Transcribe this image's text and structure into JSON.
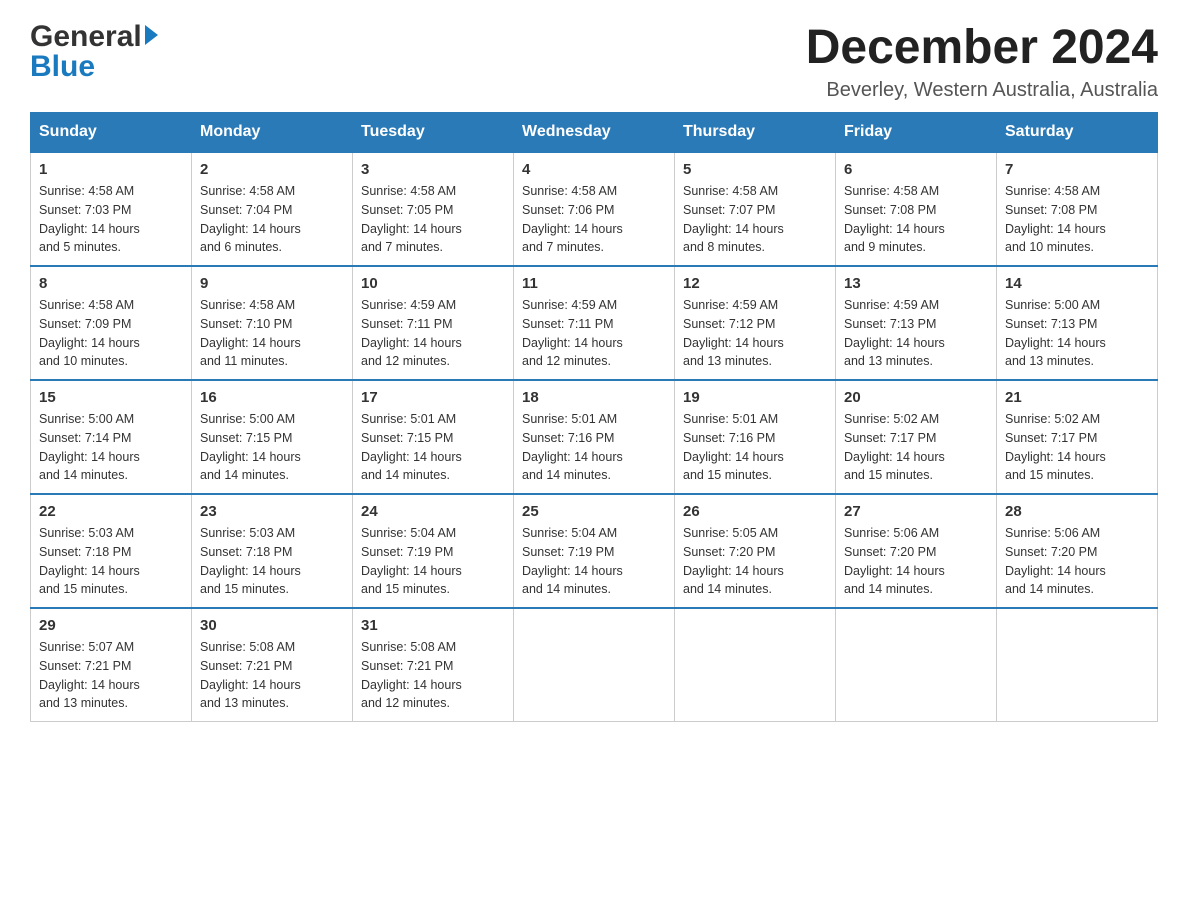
{
  "logo": {
    "top": "General",
    "bottom": "Blue"
  },
  "header": {
    "month_year": "December 2024",
    "location": "Beverley, Western Australia, Australia"
  },
  "days_of_week": [
    "Sunday",
    "Monday",
    "Tuesday",
    "Wednesday",
    "Thursday",
    "Friday",
    "Saturday"
  ],
  "weeks": [
    [
      {
        "num": "1",
        "sunrise": "4:58 AM",
        "sunset": "7:03 PM",
        "daylight": "14 hours and 5 minutes."
      },
      {
        "num": "2",
        "sunrise": "4:58 AM",
        "sunset": "7:04 PM",
        "daylight": "14 hours and 6 minutes."
      },
      {
        "num": "3",
        "sunrise": "4:58 AM",
        "sunset": "7:05 PM",
        "daylight": "14 hours and 7 minutes."
      },
      {
        "num": "4",
        "sunrise": "4:58 AM",
        "sunset": "7:06 PM",
        "daylight": "14 hours and 7 minutes."
      },
      {
        "num": "5",
        "sunrise": "4:58 AM",
        "sunset": "7:07 PM",
        "daylight": "14 hours and 8 minutes."
      },
      {
        "num": "6",
        "sunrise": "4:58 AM",
        "sunset": "7:08 PM",
        "daylight": "14 hours and 9 minutes."
      },
      {
        "num": "7",
        "sunrise": "4:58 AM",
        "sunset": "7:08 PM",
        "daylight": "14 hours and 10 minutes."
      }
    ],
    [
      {
        "num": "8",
        "sunrise": "4:58 AM",
        "sunset": "7:09 PM",
        "daylight": "14 hours and 10 minutes."
      },
      {
        "num": "9",
        "sunrise": "4:58 AM",
        "sunset": "7:10 PM",
        "daylight": "14 hours and 11 minutes."
      },
      {
        "num": "10",
        "sunrise": "4:59 AM",
        "sunset": "7:11 PM",
        "daylight": "14 hours and 12 minutes."
      },
      {
        "num": "11",
        "sunrise": "4:59 AM",
        "sunset": "7:11 PM",
        "daylight": "14 hours and 12 minutes."
      },
      {
        "num": "12",
        "sunrise": "4:59 AM",
        "sunset": "7:12 PM",
        "daylight": "14 hours and 13 minutes."
      },
      {
        "num": "13",
        "sunrise": "4:59 AM",
        "sunset": "7:13 PM",
        "daylight": "14 hours and 13 minutes."
      },
      {
        "num": "14",
        "sunrise": "5:00 AM",
        "sunset": "7:13 PM",
        "daylight": "14 hours and 13 minutes."
      }
    ],
    [
      {
        "num": "15",
        "sunrise": "5:00 AM",
        "sunset": "7:14 PM",
        "daylight": "14 hours and 14 minutes."
      },
      {
        "num": "16",
        "sunrise": "5:00 AM",
        "sunset": "7:15 PM",
        "daylight": "14 hours and 14 minutes."
      },
      {
        "num": "17",
        "sunrise": "5:01 AM",
        "sunset": "7:15 PM",
        "daylight": "14 hours and 14 minutes."
      },
      {
        "num": "18",
        "sunrise": "5:01 AM",
        "sunset": "7:16 PM",
        "daylight": "14 hours and 14 minutes."
      },
      {
        "num": "19",
        "sunrise": "5:01 AM",
        "sunset": "7:16 PM",
        "daylight": "14 hours and 15 minutes."
      },
      {
        "num": "20",
        "sunrise": "5:02 AM",
        "sunset": "7:17 PM",
        "daylight": "14 hours and 15 minutes."
      },
      {
        "num": "21",
        "sunrise": "5:02 AM",
        "sunset": "7:17 PM",
        "daylight": "14 hours and 15 minutes."
      }
    ],
    [
      {
        "num": "22",
        "sunrise": "5:03 AM",
        "sunset": "7:18 PM",
        "daylight": "14 hours and 15 minutes."
      },
      {
        "num": "23",
        "sunrise": "5:03 AM",
        "sunset": "7:18 PM",
        "daylight": "14 hours and 15 minutes."
      },
      {
        "num": "24",
        "sunrise": "5:04 AM",
        "sunset": "7:19 PM",
        "daylight": "14 hours and 15 minutes."
      },
      {
        "num": "25",
        "sunrise": "5:04 AM",
        "sunset": "7:19 PM",
        "daylight": "14 hours and 14 minutes."
      },
      {
        "num": "26",
        "sunrise": "5:05 AM",
        "sunset": "7:20 PM",
        "daylight": "14 hours and 14 minutes."
      },
      {
        "num": "27",
        "sunrise": "5:06 AM",
        "sunset": "7:20 PM",
        "daylight": "14 hours and 14 minutes."
      },
      {
        "num": "28",
        "sunrise": "5:06 AM",
        "sunset": "7:20 PM",
        "daylight": "14 hours and 14 minutes."
      }
    ],
    [
      {
        "num": "29",
        "sunrise": "5:07 AM",
        "sunset": "7:21 PM",
        "daylight": "14 hours and 13 minutes."
      },
      {
        "num": "30",
        "sunrise": "5:08 AM",
        "sunset": "7:21 PM",
        "daylight": "14 hours and 13 minutes."
      },
      {
        "num": "31",
        "sunrise": "5:08 AM",
        "sunset": "7:21 PM",
        "daylight": "14 hours and 12 minutes."
      },
      null,
      null,
      null,
      null
    ]
  ],
  "labels": {
    "sunrise": "Sunrise:",
    "sunset": "Sunset:",
    "daylight": "Daylight:"
  },
  "colors": {
    "header_bg": "#2a7ab8",
    "header_text": "#ffffff",
    "border": "#2a7ab8"
  }
}
